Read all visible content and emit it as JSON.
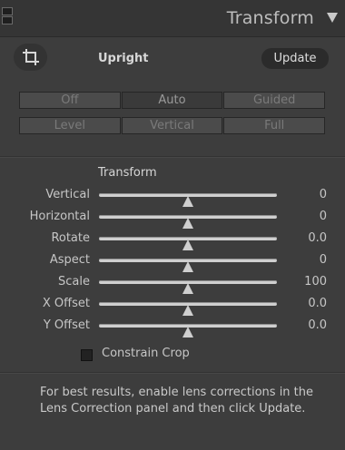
{
  "header": {
    "title": "Transform",
    "icons": {
      "grip": "panel-grip-icon",
      "collapse": "triangle-down-icon"
    }
  },
  "upright": {
    "tool_icon": "crop-icon",
    "label": "Upright",
    "update_label": "Update",
    "modes_row1": [
      "Off",
      "Auto",
      "Guided"
    ],
    "modes_row2": [
      "Level",
      "Vertical",
      "Full"
    ],
    "selected": "Auto"
  },
  "transform": {
    "title": "Transform",
    "sliders": [
      {
        "label": "Vertical",
        "value": "0",
        "position": 0.5
      },
      {
        "label": "Horizontal",
        "value": "0",
        "position": 0.5
      },
      {
        "label": "Rotate",
        "value": "0.0",
        "position": 0.5
      },
      {
        "label": "Aspect",
        "value": "0",
        "position": 0.5
      },
      {
        "label": "Scale",
        "value": "100",
        "position": 0.5
      },
      {
        "label": "X Offset",
        "value": "0.0",
        "position": 0.5
      },
      {
        "label": "Y Offset",
        "value": "0.0",
        "position": 0.5
      }
    ],
    "constrain_crop": {
      "label": "Constrain Crop",
      "checked": false
    }
  },
  "help_text": "For best results, enable lens corrections in the Lens Correction panel and then click Update."
}
